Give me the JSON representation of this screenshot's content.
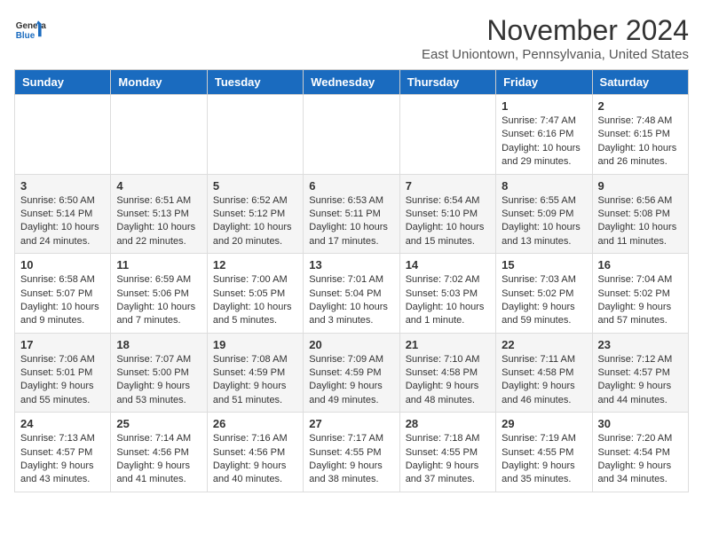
{
  "header": {
    "logo_general": "General",
    "logo_blue": "Blue",
    "month_title": "November 2024",
    "location": "East Uniontown, Pennsylvania, United States"
  },
  "days_of_week": [
    "Sunday",
    "Monday",
    "Tuesday",
    "Wednesday",
    "Thursday",
    "Friday",
    "Saturday"
  ],
  "weeks": [
    [
      {
        "day": "",
        "info": ""
      },
      {
        "day": "",
        "info": ""
      },
      {
        "day": "",
        "info": ""
      },
      {
        "day": "",
        "info": ""
      },
      {
        "day": "",
        "info": ""
      },
      {
        "day": "1",
        "info": "Sunrise: 7:47 AM\nSunset: 6:16 PM\nDaylight: 10 hours and 29 minutes."
      },
      {
        "day": "2",
        "info": "Sunrise: 7:48 AM\nSunset: 6:15 PM\nDaylight: 10 hours and 26 minutes."
      }
    ],
    [
      {
        "day": "3",
        "info": "Sunrise: 6:50 AM\nSunset: 5:14 PM\nDaylight: 10 hours and 24 minutes."
      },
      {
        "day": "4",
        "info": "Sunrise: 6:51 AM\nSunset: 5:13 PM\nDaylight: 10 hours and 22 minutes."
      },
      {
        "day": "5",
        "info": "Sunrise: 6:52 AM\nSunset: 5:12 PM\nDaylight: 10 hours and 20 minutes."
      },
      {
        "day": "6",
        "info": "Sunrise: 6:53 AM\nSunset: 5:11 PM\nDaylight: 10 hours and 17 minutes."
      },
      {
        "day": "7",
        "info": "Sunrise: 6:54 AM\nSunset: 5:10 PM\nDaylight: 10 hours and 15 minutes."
      },
      {
        "day": "8",
        "info": "Sunrise: 6:55 AM\nSunset: 5:09 PM\nDaylight: 10 hours and 13 minutes."
      },
      {
        "day": "9",
        "info": "Sunrise: 6:56 AM\nSunset: 5:08 PM\nDaylight: 10 hours and 11 minutes."
      }
    ],
    [
      {
        "day": "10",
        "info": "Sunrise: 6:58 AM\nSunset: 5:07 PM\nDaylight: 10 hours and 9 minutes."
      },
      {
        "day": "11",
        "info": "Sunrise: 6:59 AM\nSunset: 5:06 PM\nDaylight: 10 hours and 7 minutes."
      },
      {
        "day": "12",
        "info": "Sunrise: 7:00 AM\nSunset: 5:05 PM\nDaylight: 10 hours and 5 minutes."
      },
      {
        "day": "13",
        "info": "Sunrise: 7:01 AM\nSunset: 5:04 PM\nDaylight: 10 hours and 3 minutes."
      },
      {
        "day": "14",
        "info": "Sunrise: 7:02 AM\nSunset: 5:03 PM\nDaylight: 10 hours and 1 minute."
      },
      {
        "day": "15",
        "info": "Sunrise: 7:03 AM\nSunset: 5:02 PM\nDaylight: 9 hours and 59 minutes."
      },
      {
        "day": "16",
        "info": "Sunrise: 7:04 AM\nSunset: 5:02 PM\nDaylight: 9 hours and 57 minutes."
      }
    ],
    [
      {
        "day": "17",
        "info": "Sunrise: 7:06 AM\nSunset: 5:01 PM\nDaylight: 9 hours and 55 minutes."
      },
      {
        "day": "18",
        "info": "Sunrise: 7:07 AM\nSunset: 5:00 PM\nDaylight: 9 hours and 53 minutes."
      },
      {
        "day": "19",
        "info": "Sunrise: 7:08 AM\nSunset: 4:59 PM\nDaylight: 9 hours and 51 minutes."
      },
      {
        "day": "20",
        "info": "Sunrise: 7:09 AM\nSunset: 4:59 PM\nDaylight: 9 hours and 49 minutes."
      },
      {
        "day": "21",
        "info": "Sunrise: 7:10 AM\nSunset: 4:58 PM\nDaylight: 9 hours and 48 minutes."
      },
      {
        "day": "22",
        "info": "Sunrise: 7:11 AM\nSunset: 4:58 PM\nDaylight: 9 hours and 46 minutes."
      },
      {
        "day": "23",
        "info": "Sunrise: 7:12 AM\nSunset: 4:57 PM\nDaylight: 9 hours and 44 minutes."
      }
    ],
    [
      {
        "day": "24",
        "info": "Sunrise: 7:13 AM\nSunset: 4:57 PM\nDaylight: 9 hours and 43 minutes."
      },
      {
        "day": "25",
        "info": "Sunrise: 7:14 AM\nSunset: 4:56 PM\nDaylight: 9 hours and 41 minutes."
      },
      {
        "day": "26",
        "info": "Sunrise: 7:16 AM\nSunset: 4:56 PM\nDaylight: 9 hours and 40 minutes."
      },
      {
        "day": "27",
        "info": "Sunrise: 7:17 AM\nSunset: 4:55 PM\nDaylight: 9 hours and 38 minutes."
      },
      {
        "day": "28",
        "info": "Sunrise: 7:18 AM\nSunset: 4:55 PM\nDaylight: 9 hours and 37 minutes."
      },
      {
        "day": "29",
        "info": "Sunrise: 7:19 AM\nSunset: 4:55 PM\nDaylight: 9 hours and 35 minutes."
      },
      {
        "day": "30",
        "info": "Sunrise: 7:20 AM\nSunset: 4:54 PM\nDaylight: 9 hours and 34 minutes."
      }
    ]
  ]
}
